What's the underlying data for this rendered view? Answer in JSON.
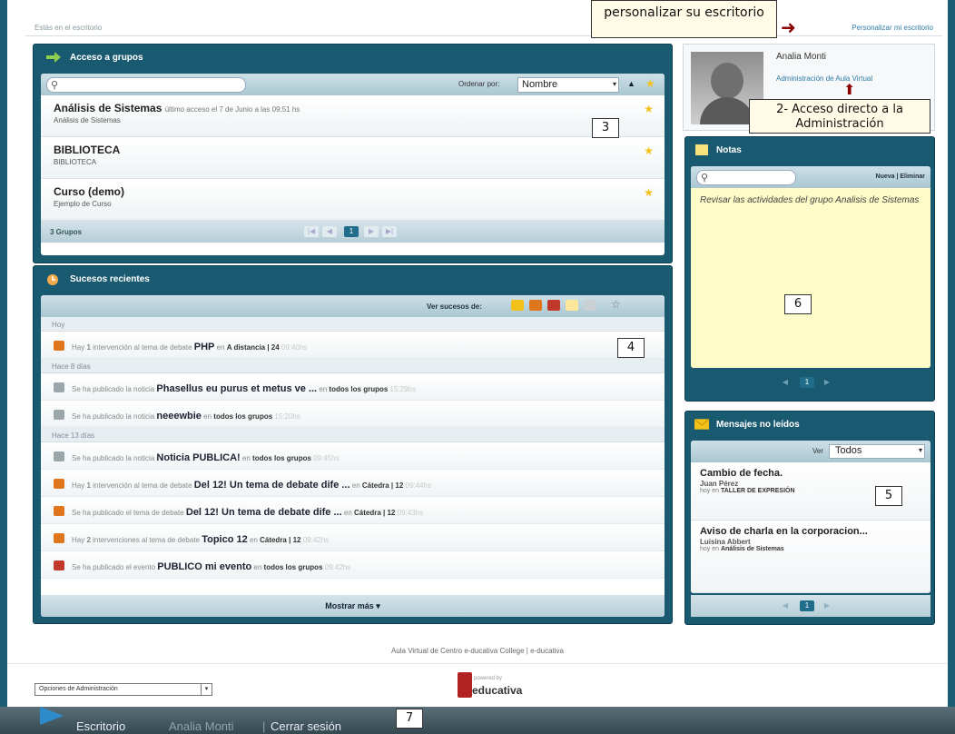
{
  "header": {
    "breadcrumb": "Estás en el escritorio",
    "customize_link": "Personalizar mi escritorio",
    "callout_customize": "personalizar su escritorio"
  },
  "groups_panel": {
    "title": "Acceso a grupos",
    "search_placeholder": "",
    "sort_label": "Ordenar por:",
    "sort_value": "Nombre",
    "sort_dir": "▲",
    "callout_number": "3",
    "groups": [
      {
        "name": "Análisis de Sistemas",
        "last_access": "último acceso el 7 de Junio a las 09:51 hs",
        "desc": "Análisis de Sistemas"
      },
      {
        "name": "BIBLIOTECA",
        "last_access": "",
        "desc": "BIBLIOTECA"
      },
      {
        "name": "Curso (demo)",
        "last_access": "",
        "desc": "Ejemplo de Curso"
      }
    ],
    "count_label": "3 Grupos",
    "current_page": "1"
  },
  "events_panel": {
    "title": "Sucesos recientes",
    "filter_label": "Ver sucesos de:",
    "callout_number": "4",
    "sections": [
      {
        "day": "Hoy",
        "rows": [
          {
            "icon": "debate-icon",
            "color": "#e0761c",
            "pre": "Hay ",
            "count": "1",
            "text": " intervención al tema de debate ",
            "big": "PHP",
            "mid": " en ",
            "loc": "A distancia | 24",
            "time": " 09:40hs"
          }
        ]
      },
      {
        "day": "Hace 8 días",
        "rows": [
          {
            "icon": "news-icon",
            "color": "#9aa6aa",
            "pre": "",
            "count": "",
            "text": "Se ha publicado la noticia ",
            "big": "Phasellus eu purus et metus ve ...",
            "mid": " en ",
            "loc": "todos los grupos",
            "time": " 15:29hs"
          },
          {
            "icon": "news-icon",
            "color": "#9aa6aa",
            "pre": "",
            "count": "",
            "text": "Se ha publicado la noticia ",
            "big": "neeewbie",
            "mid": " en ",
            "loc": "todos los grupos",
            "time": " 15:20hs"
          }
        ]
      },
      {
        "day": "Hace 13 días",
        "rows": [
          {
            "icon": "news-icon",
            "color": "#9aa6aa",
            "pre": "",
            "count": "",
            "text": "Se ha publicado la noticia ",
            "big": "Noticia PUBLICA!",
            "mid": " en ",
            "loc": "todos los grupos",
            "time": " 09:45hs"
          },
          {
            "icon": "debate-icon",
            "color": "#e0761c",
            "pre": "Hay ",
            "count": "1",
            "text": " intervención al tema de debate ",
            "big": "Del 12! Un tema de debate dife ...",
            "mid": " en ",
            "loc": "Cátedra | 12",
            "time": " 09:44hs"
          },
          {
            "icon": "debate-icon",
            "color": "#e0761c",
            "pre": "",
            "count": "",
            "text": "Se ha publicado el tema de debate ",
            "big": "Del 12! Un tema de debate dife ...",
            "mid": " en ",
            "loc": "Cátedra | 12",
            "time": " 09:43hs"
          },
          {
            "icon": "debate-icon",
            "color": "#e0761c",
            "pre": "Hay ",
            "count": "2",
            "text": " intervenciones al tema de debate ",
            "big": "Topico 12",
            "mid": " en ",
            "loc": "Cátedra | 12",
            "time": " 09:42hs"
          },
          {
            "icon": "event-icon",
            "color": "#c0392b",
            "pre": "",
            "count": "",
            "text": "Se ha publicado el evento ",
            "big": "PUBLICO mi evento",
            "mid": " en ",
            "loc": "todos los grupos",
            "time": " 09:42hs"
          }
        ]
      }
    ],
    "show_more": "Mostrar más ▾"
  },
  "profile": {
    "name": "Analia Monti",
    "admin_link": "Administración de Aula Virtual",
    "callout": "2- Acceso directo a la Administración"
  },
  "notes_panel": {
    "title": "Notas",
    "actions": "Nueva | Eliminar",
    "note": "Revisar las actividades del grupo Analisis de Sistemas",
    "callout_number": "6",
    "current_page": "1"
  },
  "messages_panel": {
    "title": "Mensajes no leídos",
    "view_label": "Ver",
    "view_value": "Todos",
    "callout_number": "5",
    "messages": [
      {
        "title": "Cambio de fecha.",
        "from": "Juan Pérez",
        "meta_pre": "hoy en ",
        "group": "TALLER DE EXPRESIÓN"
      },
      {
        "title": "Aviso de charla en la corporacion...",
        "from": "Luisina Abbert",
        "meta_pre": "hoy en ",
        "group": "Análisis de Sistemas"
      }
    ],
    "current_page": "1"
  },
  "footer": {
    "text": "Aula Virtual de Centro e-ducativa College | e-ducativa",
    "admin_select": "Opciones de Administración",
    "brand": "educativa",
    "brand_tag": "powered by"
  },
  "taskbar": {
    "desktop": "Escritorio",
    "user": "Analia Monti",
    "sep": "|",
    "logout": "Cerrar sesión",
    "callout_number": "7"
  },
  "colors": {
    "panel": "#1a5a70",
    "accent": "#2d7ca8",
    "note_bg": "#fdfcc8"
  }
}
